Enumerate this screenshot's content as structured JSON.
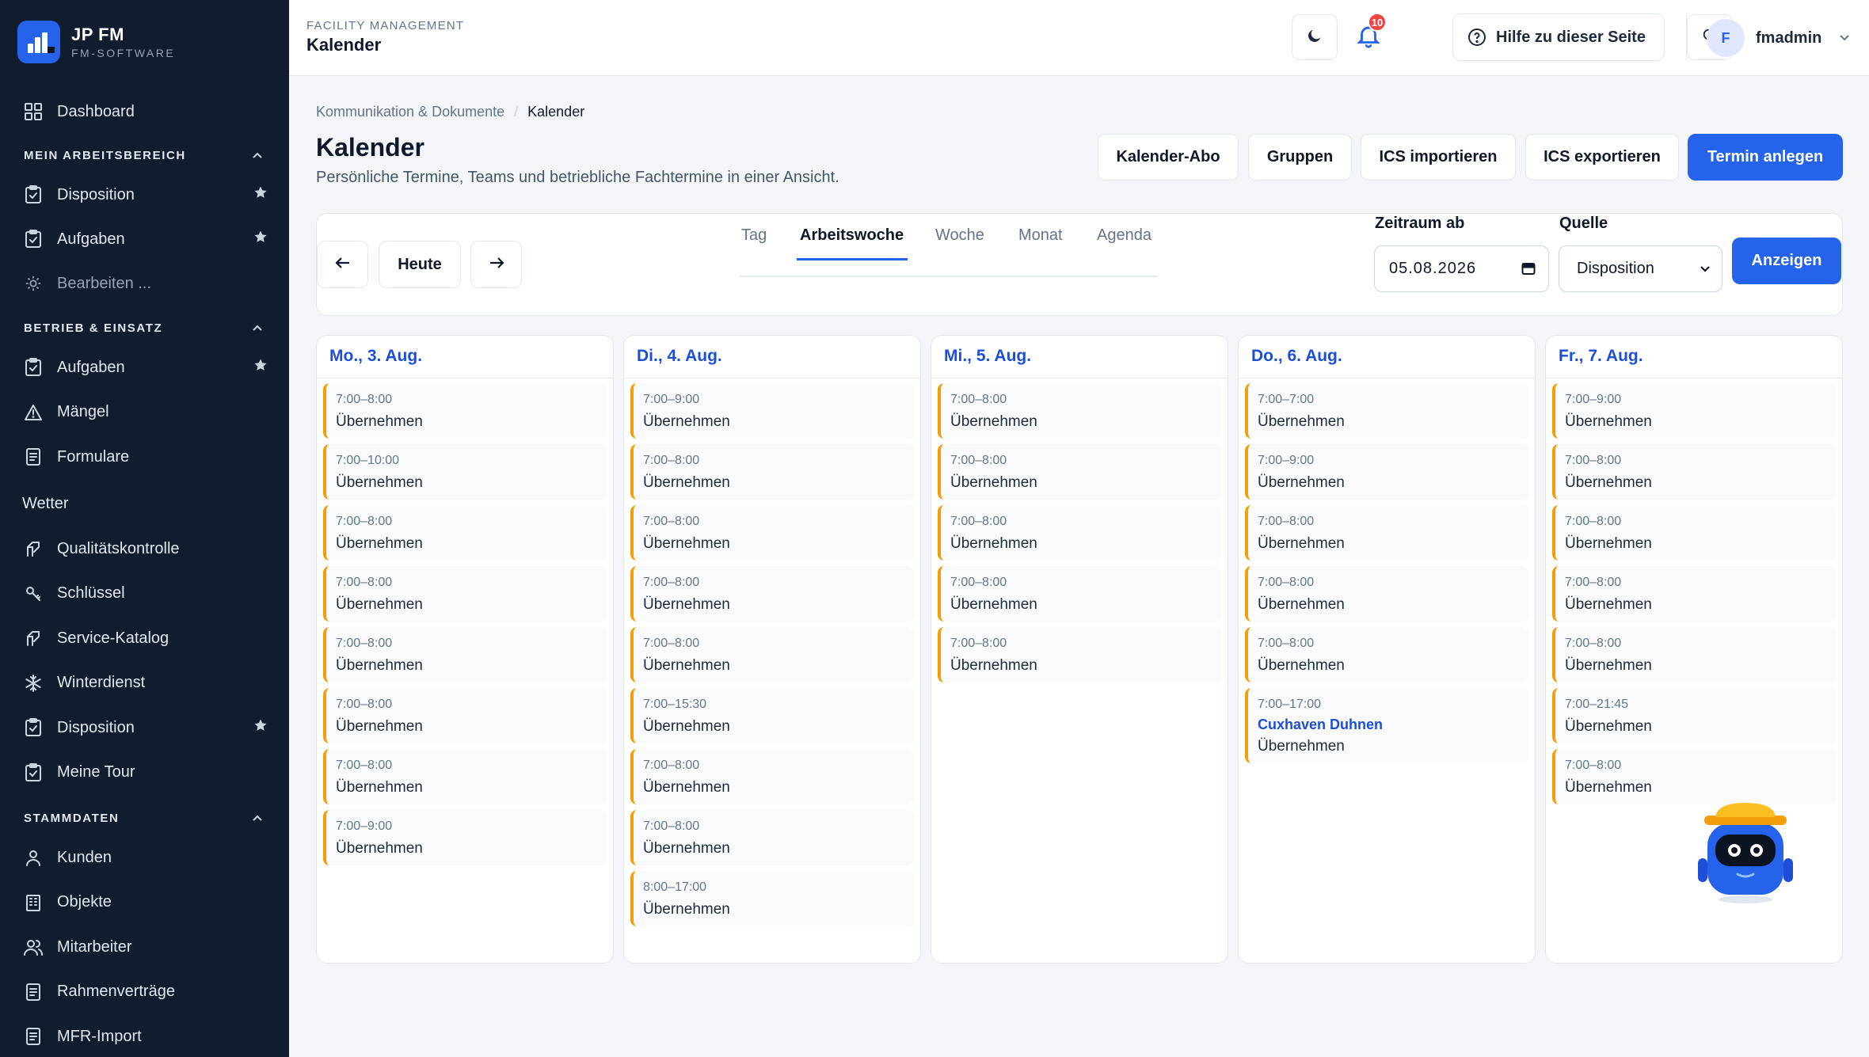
{
  "brand": {
    "title": "JP FM",
    "subtitle": "FM-SOFTWARE"
  },
  "sidebar": {
    "dashboard": "Dashboard",
    "section_work": "MEIN ARBEITSBEREICH",
    "work_items": [
      {
        "label": "Disposition",
        "icon": "clipboard-check-icon",
        "starred": true
      },
      {
        "label": "Aufgaben",
        "icon": "clipboard-check-icon",
        "starred": true
      },
      {
        "label": "Bearbeiten ...",
        "icon": "gear-icon",
        "starred": false
      }
    ],
    "section_ops": "BETRIEB & EINSATZ",
    "ops_items": [
      {
        "label": "Aufgaben",
        "icon": "clipboard-check-icon",
        "starred": true
      },
      {
        "label": "Mängel",
        "icon": "warning-triangle-icon",
        "starred": false
      },
      {
        "label": "Formulare",
        "icon": "document-icon",
        "starred": false
      }
    ],
    "plain_item": "Wetter",
    "ops_items_2": [
      {
        "label": "Qualitätskontrolle",
        "icon": "tag-icon",
        "starred": false
      },
      {
        "label": "Schlüssel",
        "icon": "key-icon",
        "starred": false
      },
      {
        "label": "Service-Katalog",
        "icon": "tag-icon",
        "starred": false
      },
      {
        "label": "Winterdienst",
        "icon": "snowflake-icon",
        "starred": false
      },
      {
        "label": "Disposition",
        "icon": "clipboard-check-icon",
        "starred": true
      },
      {
        "label": "Meine Tour",
        "icon": "clipboard-check-icon",
        "starred": false
      }
    ],
    "section_master": "STAMMDATEN",
    "master_items": [
      {
        "label": "Kunden",
        "icon": "user-icon"
      },
      {
        "label": "Objekte",
        "icon": "building-icon"
      },
      {
        "label": "Mitarbeiter",
        "icon": "users-icon"
      },
      {
        "label": "Rahmenverträge",
        "icon": "document-icon"
      },
      {
        "label": "MFR-Import",
        "icon": "document-icon"
      }
    ]
  },
  "header": {
    "eyebrow": "FACILITY MANAGEMENT",
    "title": "Kalender",
    "notifications": "10",
    "help": "Hilfe zu dieser Seite",
    "avatar": "F",
    "user": "fmadmin"
  },
  "page": {
    "breadcrumb_parent": "Kommunikation & Dokumente",
    "breadcrumb_sep": "/",
    "breadcrumb_current": "Kalender",
    "title": "Kalender",
    "subtitle": "Persönliche Termine, Teams und betriebliche Fachtermine in einer Ansicht.",
    "actions": [
      "Kalender-Abo",
      "Gruppen",
      "ICS importieren",
      "ICS exportieren",
      "Termin anlegen"
    ]
  },
  "toolbar": {
    "today": "Heute",
    "views": [
      "Tag",
      "Arbeitswoche",
      "Woche",
      "Monat",
      "Agenda"
    ],
    "active_view": "Arbeitswoche",
    "range_label": "Zeitraum ab",
    "range_value": "05.08.2026",
    "source_label": "Quelle",
    "source_value": "Disposition",
    "show": "Anzeigen"
  },
  "days": [
    {
      "label": "Mo., 3. Aug.",
      "events": [
        {
          "time": "7:00–8:00",
          "label": "Übernehmen"
        },
        {
          "time": "7:00–10:00",
          "label": "Übernehmen"
        },
        {
          "time": "7:00–8:00",
          "label": "Übernehmen"
        },
        {
          "time": "7:00–8:00",
          "label": "Übernehmen"
        },
        {
          "time": "7:00–8:00",
          "label": "Übernehmen"
        },
        {
          "time": "7:00–8:00",
          "label": "Übernehmen"
        },
        {
          "time": "7:00–8:00",
          "label": "Übernehmen"
        },
        {
          "time": "7:00–9:00",
          "label": "Übernehmen"
        }
      ]
    },
    {
      "label": "Di., 4. Aug.",
      "events": [
        {
          "time": "7:00–9:00",
          "label": "Übernehmen"
        },
        {
          "time": "7:00–8:00",
          "label": "Übernehmen"
        },
        {
          "time": "7:00–8:00",
          "label": "Übernehmen"
        },
        {
          "time": "7:00–8:00",
          "label": "Übernehmen"
        },
        {
          "time": "7:00–8:00",
          "label": "Übernehmen"
        },
        {
          "time": "7:00–15:30",
          "label": "Übernehmen"
        },
        {
          "time": "7:00–8:00",
          "label": "Übernehmen"
        },
        {
          "time": "7:00–8:00",
          "label": "Übernehmen"
        },
        {
          "time": "8:00–17:00",
          "label": "Übernehmen"
        }
      ]
    },
    {
      "label": "Mi., 5. Aug.",
      "events": [
        {
          "time": "7:00–8:00",
          "label": "Übernehmen"
        },
        {
          "time": "7:00–8:00",
          "label": "Übernehmen"
        },
        {
          "time": "7:00–8:00",
          "label": "Übernehmen"
        },
        {
          "time": "7:00–8:00",
          "label": "Übernehmen"
        },
        {
          "time": "7:00–8:00",
          "label": "Übernehmen"
        }
      ]
    },
    {
      "label": "Do., 6. Aug.",
      "events": [
        {
          "time": "7:00–7:00",
          "label": "Übernehmen"
        },
        {
          "time": "7:00–9:00",
          "label": "Übernehmen"
        },
        {
          "time": "7:00–8:00",
          "label": "Übernehmen"
        },
        {
          "time": "7:00–8:00",
          "label": "Übernehmen"
        },
        {
          "time": "7:00–8:00",
          "label": "Übernehmen"
        },
        {
          "time": "7:00–17:00",
          "title": "Cuxhaven Duhnen",
          "label": "Übernehmen"
        }
      ]
    },
    {
      "label": "Fr., 7. Aug.",
      "events": [
        {
          "time": "7:00–9:00",
          "label": "Übernehmen"
        },
        {
          "time": "7:00–8:00",
          "label": "Übernehmen"
        },
        {
          "time": "7:00–8:00",
          "label": "Übernehmen"
        },
        {
          "time": "7:00–8:00",
          "label": "Übernehmen"
        },
        {
          "time": "7:00–8:00",
          "label": "Übernehmen"
        },
        {
          "time": "7:00–21:45",
          "label": "Übernehmen"
        },
        {
          "time": "7:00–8:00",
          "label": "Übernehmen"
        }
      ]
    }
  ],
  "colors": {
    "sidebar_bg": "#111c2e",
    "accent": "#2563eb",
    "event_bar": "#f59e0b",
    "badge": "#ef4444"
  }
}
